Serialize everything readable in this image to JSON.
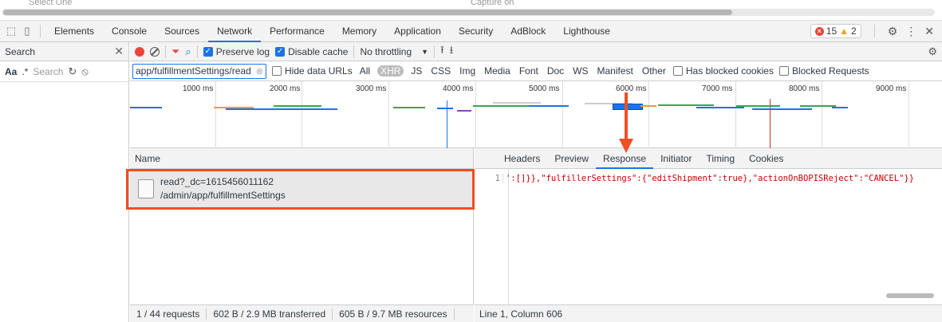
{
  "top_strip": {
    "ghost_left": "Select One",
    "ghost_right": "Capture on"
  },
  "tabbar": {
    "tabs": [
      "Elements",
      "Console",
      "Sources",
      "Network",
      "Performance",
      "Memory",
      "Application",
      "Security",
      "AdBlock",
      "Lighthouse"
    ],
    "active_tab": "Network",
    "error_count": "15",
    "warning_count": "2"
  },
  "search_panel": {
    "title": "Search",
    "case_label": "Aa",
    "regex_label": ".*",
    "placeholder": "Search"
  },
  "net_toolbar": {
    "preserve_log": "Preserve log",
    "disable_cache": "Disable cache",
    "throttling": "No throttling"
  },
  "filter_bar": {
    "filter_value": "app/fulfillmentSettings/read",
    "hide_data_urls": "Hide data URLs",
    "types": [
      "All",
      "XHR",
      "JS",
      "CSS",
      "Img",
      "Media",
      "Font",
      "Doc",
      "WS",
      "Manifest",
      "Other"
    ],
    "selected_type": "XHR",
    "has_blocked_cookies": "Has blocked cookies",
    "blocked_requests": "Blocked Requests"
  },
  "overview": {
    "ticks": [
      "1000 ms",
      "2000 ms",
      "3000 ms",
      "4000 ms",
      "5000 ms",
      "6000 ms",
      "7000 ms",
      "8000 ms",
      "9000 ms"
    ]
  },
  "requests": {
    "column_name": "Name",
    "rows": [
      {
        "name": "read?_dc=1615456011162",
        "path": "/admin/app/fulfillmentSettings"
      }
    ]
  },
  "detail": {
    "tabs": [
      "Headers",
      "Preview",
      "Response",
      "Initiator",
      "Timing",
      "Cookies"
    ],
    "active_tab": "Response",
    "line_number": "1",
    "response_code": "':[]}},\"fulfillerSettings\":{\"editShipment\":true},\"actionOnBOPISReject\":\"CANCEL\"}}"
  },
  "status": {
    "requests": "1 / 44 requests",
    "transferred": "602 B / 2.9 MB transferred",
    "resources": "605 B / 9.7 MB resources",
    "cursor": "Line 1, Column 606"
  },
  "colors": {
    "accent": "#1a73e8",
    "annotation": "#f04e23",
    "error": "#e8453c"
  }
}
